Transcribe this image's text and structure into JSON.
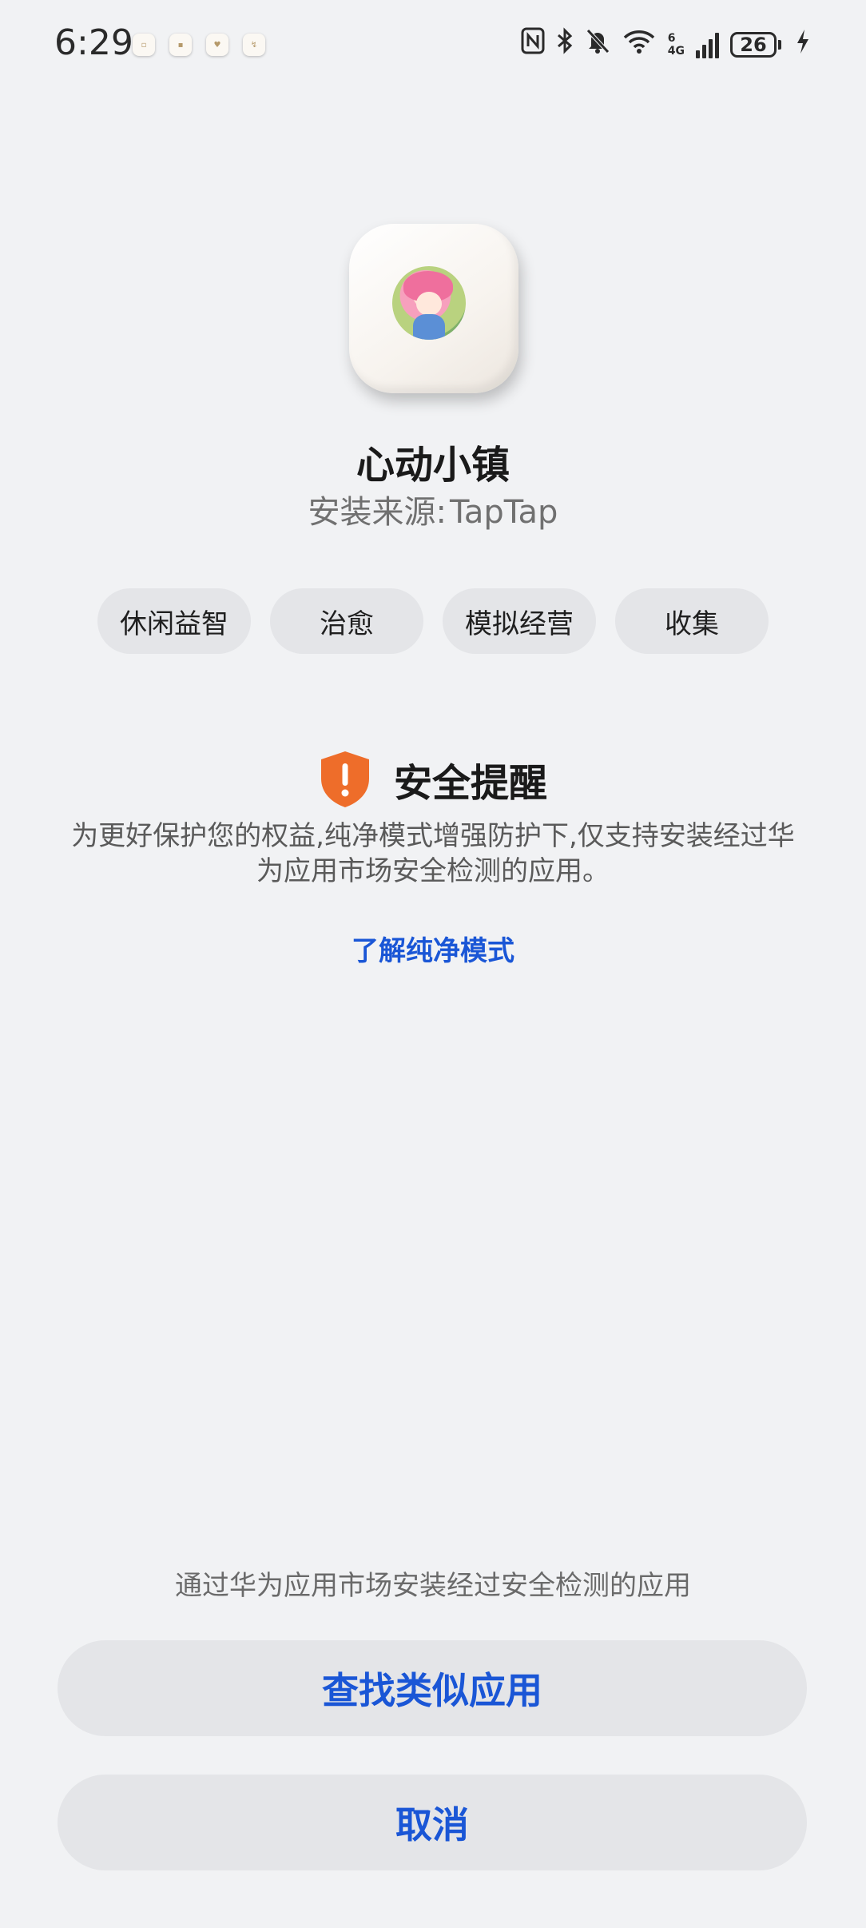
{
  "status_bar": {
    "time": "6:29",
    "notification_icons": [
      "app-notification-icon",
      "app-notification-icon",
      "app-notification-icon",
      "app-notification-icon"
    ],
    "network_generation_top": "6",
    "network_type": "4G",
    "battery_level": "26",
    "charging": true
  },
  "app": {
    "name": "心动小镇",
    "install_source_label": "安装来源:",
    "install_source_value": "TapTap",
    "tags": [
      "休闲益智",
      "治愈",
      "模拟经营",
      "收集"
    ]
  },
  "security": {
    "title": "安全提醒",
    "description": "为更好保护您的权益,纯净模式增强防护下,仅支持安装经过华为应用市场安全检测的应用。",
    "learn_more_link": "了解纯净模式",
    "icon_color": "#ee6d2a"
  },
  "footer": {
    "hint": "通过华为应用市场安装经过安全检测的应用",
    "find_similar_button": "查找类似应用",
    "cancel_button": "取消",
    "accent_color": "#1a56d6"
  }
}
